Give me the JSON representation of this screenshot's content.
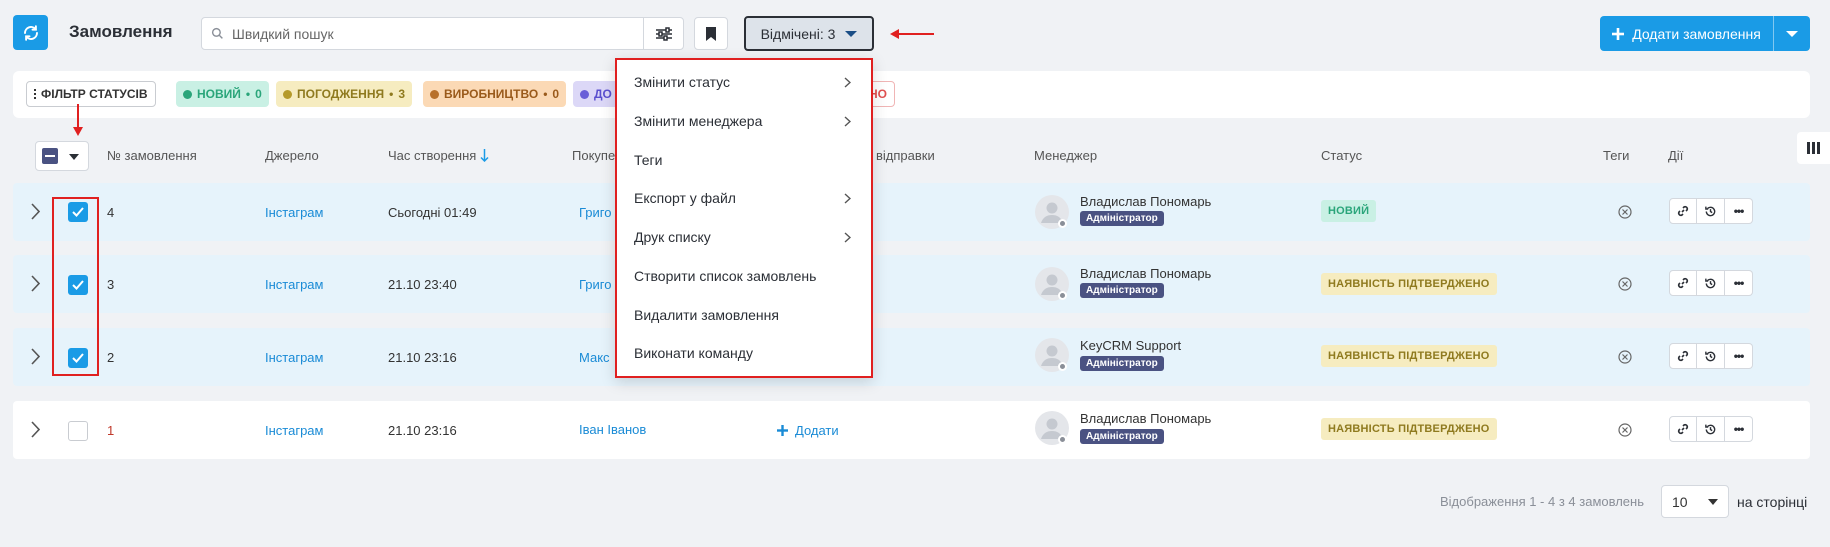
{
  "header": {
    "title": "Замовлення",
    "search_placeholder": "Швидкий пошук",
    "selected_label": "Відмічені: 3",
    "add_order_label": "Додати замовлення"
  },
  "status_filter": {
    "filter_label": "ФІЛЬТР СТАТУСІВ",
    "chips": [
      {
        "label": "НОВИЙ",
        "count": "0",
        "bg": "#c9f0e4",
        "fg": "#2aa57a",
        "dot": "#2aa57a"
      },
      {
        "label": "ПОГОДЖЕННЯ",
        "count": "3",
        "bg": "#f6ecc0",
        "fg": "#8f7a1f",
        "dot": "#b59a2a"
      },
      {
        "label": "ВИРОБНИЦТВО",
        "count": "0",
        "bg": "#fbd9b5",
        "fg": "#9a5a1b",
        "dot": "#b8702a"
      },
      {
        "label": "ДО",
        "bg": "#dcd8f7",
        "fg": "#5a4fcf",
        "dot": "#6a5fd8"
      }
    ],
    "partial_chip_tail": "НО"
  },
  "table": {
    "headers": [
      "№ замовлення",
      "Джерело",
      "Час створення",
      "Покупе",
      "відправки",
      "Менеджер",
      "Статус",
      "Теги",
      "Дії"
    ],
    "rows": [
      {
        "number": "4",
        "source": "Інстаграм",
        "created": "Сьогодні 01:49",
        "buyer": "Григо",
        "manager": "Владислав Пономарь",
        "role": "Адміністратор",
        "status": "НОВИЙ",
        "status_type": "new",
        "checked": true
      },
      {
        "number": "3",
        "source": "Інстаграм",
        "created": "21.10 23:40",
        "buyer": "Григо",
        "manager": "Владислав Пономарь",
        "role": "Адміністратор",
        "status": "НАЯВНІСТЬ ПІДТВЕРДЖЕНО",
        "status_type": "conf",
        "checked": true
      },
      {
        "number": "2",
        "source": "Інстаграм",
        "created": "21.10 23:16",
        "buyer": "Макс",
        "manager": "KeyCRM Support",
        "role": "Адміністратор",
        "status": "НАЯВНІСТЬ ПІДТВЕРДЖЕНО",
        "status_type": "conf",
        "checked": true
      },
      {
        "number": "1",
        "source": "Інстаграм",
        "created": "21.10 23:16",
        "buyer": "Іван Іванов",
        "delivery_add": "Додати",
        "manager": "Владислав Пономарь",
        "role": "Адміністратор",
        "status": "НАЯВНІСТЬ ПІДТВЕРДЖЕНО",
        "status_type": "conf",
        "checked": false
      }
    ]
  },
  "bulk_menu": {
    "items": [
      {
        "label": "Змінити статус",
        "submenu": true
      },
      {
        "label": "Змінити менеджера",
        "submenu": true
      },
      {
        "label": "Теги",
        "submenu": false
      },
      {
        "label": "Експорт у файл",
        "submenu": true
      },
      {
        "label": "Друк списку",
        "submenu": true
      },
      {
        "label": "Створити список замовлень",
        "submenu": false
      },
      {
        "label": "Видалити замовлення",
        "submenu": false
      },
      {
        "label": "Виконати команду",
        "submenu": false
      }
    ]
  },
  "footer": {
    "info": "Відображення 1 - 4 з 4 замовлень",
    "per_page_value": "10",
    "per_page_label": "на сторінці"
  },
  "colors": {
    "accent": "#1a9be6",
    "highlight": "#e02020"
  }
}
